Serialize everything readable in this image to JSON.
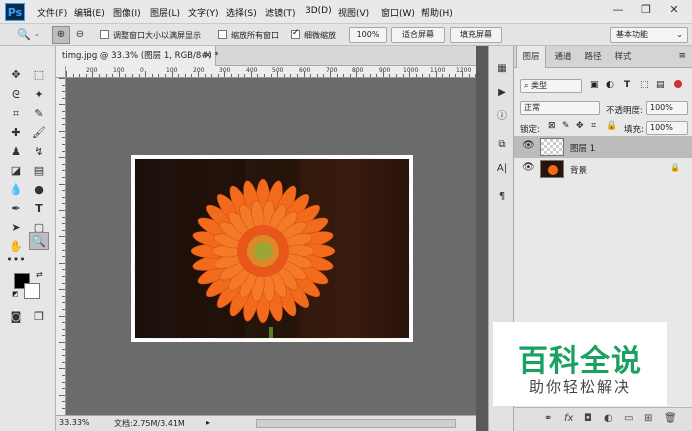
{
  "app": {
    "logo": "Ps"
  },
  "menu": [
    "文件(F)",
    "编辑(E)",
    "图像(I)",
    "图层(L)",
    "文字(Y)",
    "选择(S)",
    "滤镜(T)",
    "3D(D)",
    "视图(V)",
    "窗口(W)",
    "帮助(H)"
  ],
  "window_controls": {
    "minimize": "—",
    "restore": "❐",
    "close": "✕"
  },
  "options": {
    "resize_windows": "调整窗口大小以满屏显示",
    "zoom_all": "缩放所有窗口",
    "scrubby_zoom": "细微缩放",
    "zoom_value": "100%",
    "fit_screen": "适合屏幕",
    "fill_screen": "填充屏幕",
    "workspace": "基本功能"
  },
  "document": {
    "tab_title": "timg.jpg @ 33.3% (图层 1, RGB/8#) *",
    "zoom": "33.33%",
    "doc_info": "文档:2.75M/3.41M",
    "ruler_numbers": [
      "200",
      "100",
      "0",
      "100",
      "200",
      "300",
      "400",
      "500",
      "600",
      "700",
      "800",
      "900",
      "1000",
      "1100",
      "1200"
    ]
  },
  "layers_panel": {
    "tabs": [
      "图层",
      "通道",
      "路径",
      "样式"
    ],
    "filter": "类型",
    "blend_mode": "正常",
    "opacity_label": "不透明度:",
    "opacity_value": "100%",
    "lock_label": "锁定:",
    "fill_label": "填充:",
    "fill_value": "100%",
    "layers": [
      {
        "name": "图层 1"
      },
      {
        "name": "背景"
      }
    ]
  },
  "watermark": {
    "title": "百科全说",
    "subtitle": "助你轻松解决"
  },
  "colors": {
    "flower": "#f26a1b",
    "flower_center": "#9aa636",
    "watermark_green": "#1aa160"
  }
}
